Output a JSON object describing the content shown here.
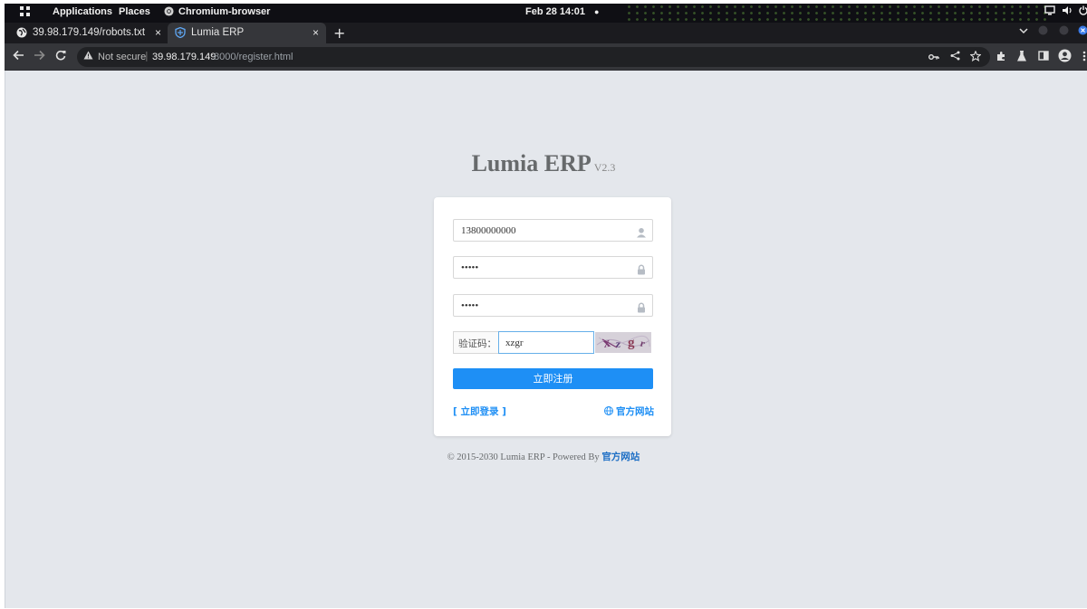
{
  "system_bar": {
    "applications": "Applications",
    "places": "Places",
    "browser_name": "Chromium-browser",
    "clock": "Feb 28  14:01",
    "status_dot": "●"
  },
  "tabs": [
    {
      "label": "39.98.179.149/robots.txt",
      "icon": "globe-icon",
      "close": "×"
    },
    {
      "label": "Lumia ERP",
      "icon": "shield-icon",
      "close": "×"
    }
  ],
  "new_tab": "+",
  "address_bar": {
    "security": "Not secure",
    "separator": "|",
    "host": "39.98.179.149",
    "path": ":8000/register.html"
  },
  "brand": {
    "title": "Lumia ERP",
    "version": "V2.3"
  },
  "form": {
    "phone_value": "13800000000",
    "password_value": "•••••",
    "confirm_value": "•••••",
    "captcha_label": "验证码：",
    "captcha_value": "xzgr",
    "captcha_image_text": "xzgr",
    "submit_label": "立即注册",
    "login_link": "[ 立即登录 ]",
    "site_link": "官方网站"
  },
  "footer": {
    "text": "© 2015-2030 Lumia ERP - Powered By ",
    "link": "官方网站"
  },
  "colors": {
    "accent": "#1e8ff5",
    "page_bg": "#e4e7ec",
    "title_gray": "#676a6c"
  }
}
